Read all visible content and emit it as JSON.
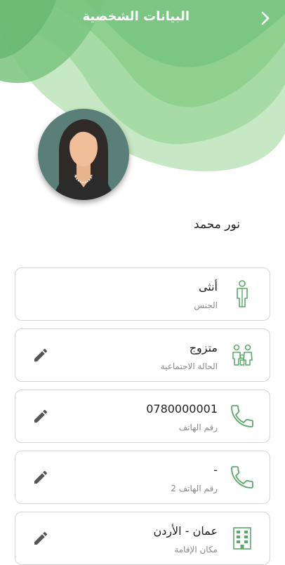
{
  "header": {
    "title": "البيانات الشخصية"
  },
  "profile": {
    "name": "نور محمد"
  },
  "fields": [
    {
      "value": "أنثى",
      "label": "الجنس"
    },
    {
      "value": "متزوج",
      "label": "الحالة الاجتماعية"
    },
    {
      "value": "0780000001",
      "label": "رقم الهاتف"
    },
    {
      "value": "-",
      "label": "رقم الهاتف 2"
    },
    {
      "value": "عمان - الأردن",
      "label": "مكان الإقامة"
    }
  ],
  "icons": {
    "back": "chevron-right-icon",
    "gender": "person-icon",
    "marital": "family-icon",
    "phone": "phone-icon",
    "phone2": "phone-icon",
    "residence": "building-icon",
    "edit": "pencil-icon"
  },
  "colors": {
    "accent": "#5aa96a",
    "header_light": "#b9e2b8",
    "header_dark": "#6fbf78"
  }
}
